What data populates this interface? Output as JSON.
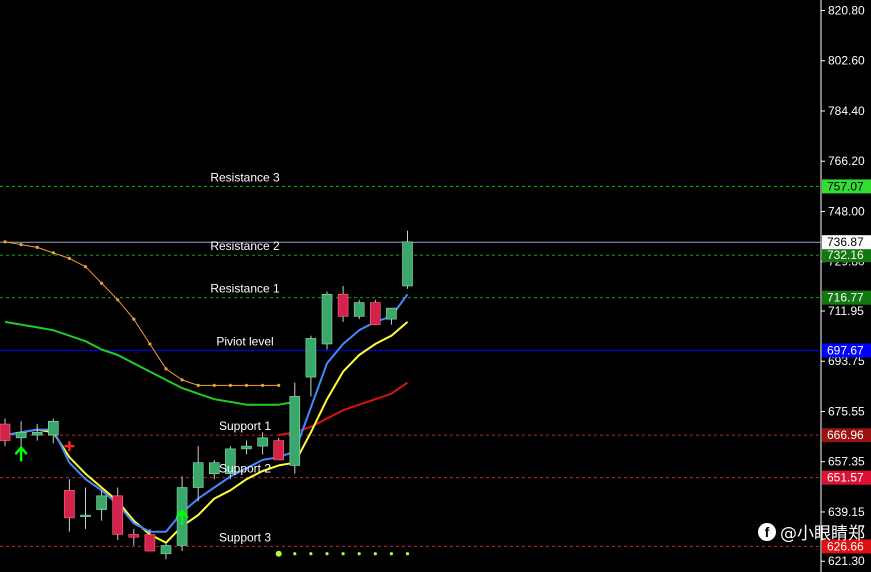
{
  "chart_data": {
    "type": "candlestick",
    "y_axis": {
      "ylim": [
        617.4,
        824.6
      ],
      "ticks": [
        "820.80",
        "802.60",
        "784.40",
        "766.20",
        "748.00",
        "729.80",
        "711.95",
        "693.75",
        "675.55",
        "657.35",
        "639.15",
        "621.30"
      ],
      "tick_values": [
        820.8,
        802.6,
        784.4,
        766.2,
        748.0,
        729.8,
        711.95,
        693.75,
        675.55,
        657.35,
        639.15,
        621.3
      ]
    },
    "candles": [
      {
        "o": 671,
        "h": 673,
        "l": 663,
        "c": 665
      },
      {
        "o": 666,
        "h": 672,
        "l": 663,
        "c": 668
      },
      {
        "o": 667,
        "h": 671,
        "l": 665,
        "c": 668
      },
      {
        "o": 667,
        "h": 673,
        "l": 664,
        "c": 672
      },
      {
        "o": 647,
        "h": 651,
        "l": 632,
        "c": 637
      },
      {
        "o": 638,
        "h": 648,
        "l": 633,
        "c": 638
      },
      {
        "o": 640,
        "h": 647,
        "l": 636,
        "c": 645
      },
      {
        "o": 645,
        "h": 648,
        "l": 629,
        "c": 631
      },
      {
        "o": 631,
        "h": 633,
        "l": 627,
        "c": 630
      },
      {
        "o": 631,
        "h": 633,
        "l": 625,
        "c": 625
      },
      {
        "o": 624,
        "h": 628,
        "l": 622,
        "c": 627
      },
      {
        "o": 627,
        "h": 652,
        "l": 625,
        "c": 648
      },
      {
        "o": 648,
        "h": 663,
        "l": 643,
        "c": 657
      },
      {
        "o": 653,
        "h": 658,
        "l": 651,
        "c": 657
      },
      {
        "o": 653,
        "h": 663,
        "l": 651,
        "c": 662
      },
      {
        "o": 662,
        "h": 665,
        "l": 660,
        "c": 663
      },
      {
        "o": 663,
        "h": 668,
        "l": 660,
        "c": 666
      },
      {
        "o": 665,
        "h": 666,
        "l": 658,
        "c": 658
      },
      {
        "o": 656,
        "h": 686,
        "l": 653,
        "c": 681
      },
      {
        "o": 688,
        "h": 703,
        "l": 681,
        "c": 702
      },
      {
        "o": 700,
        "h": 719,
        "l": 698,
        "c": 718
      },
      {
        "o": 718,
        "h": 721,
        "l": 708,
        "c": 710
      },
      {
        "o": 710,
        "h": 716,
        "l": 709,
        "c": 715
      },
      {
        "o": 715,
        "h": 716,
        "l": 707,
        "c": 707
      },
      {
        "o": 709,
        "h": 713,
        "l": 707,
        "c": 713
      },
      {
        "o": 721,
        "h": 741,
        "l": 720,
        "c": 737
      }
    ],
    "series": [
      {
        "color": "#f0a030",
        "style": "dotted",
        "values": [
          737,
          736,
          735,
          733,
          731,
          728,
          722,
          716,
          709,
          700,
          691,
          687,
          685,
          685,
          685,
          685,
          685,
          685,
          null,
          null,
          null,
          null,
          null,
          null,
          null,
          null
        ]
      },
      {
        "color": "#22cc22",
        "values": [
          708,
          707,
          706,
          705,
          703,
          701,
          698,
          696,
          693,
          690,
          687,
          684,
          682,
          680,
          679,
          678,
          678,
          678,
          679,
          null,
          null,
          null,
          null,
          null,
          null,
          null
        ]
      },
      {
        "color": "#dd1111",
        "values": [
          null,
          null,
          null,
          null,
          null,
          null,
          null,
          null,
          null,
          null,
          null,
          null,
          null,
          null,
          null,
          null,
          null,
          667,
          668,
          670,
          673,
          676,
          678,
          680,
          682,
          686
        ]
      },
      {
        "color": "#ffff33",
        "values": [
          667,
          668,
          669,
          668,
          659,
          653,
          648,
          643,
          636,
          631,
          628,
          634,
          638,
          644,
          647,
          651,
          654,
          656,
          657,
          668,
          680,
          690,
          696,
          700,
          703,
          708
        ]
      },
      {
        "color": "#4488ff",
        "values": [
          667,
          668,
          669,
          669,
          657,
          651,
          647,
          642,
          635,
          632,
          632,
          639,
          644,
          648,
          652,
          655,
          658,
          659,
          661,
          677,
          693,
          700,
          705,
          708,
          710,
          718
        ]
      }
    ],
    "levels": [
      {
        "label": "Resistance 3",
        "value": 757.07,
        "tag": "757.07",
        "color": "#00cc00",
        "tag_bg": "#33dd33",
        "tag_fg": "#000000"
      },
      {
        "label": "Resistance 2",
        "value": 732.16,
        "tag": "732.16",
        "color": "#00aa00",
        "tag_bg": "#117711",
        "tag_fg": "#ffffff"
      },
      {
        "label": "Resistance 1",
        "value": 716.77,
        "tag": "716.77",
        "color": "#00aa00",
        "tag_bg": "#117711",
        "tag_fg": "#ffffff"
      },
      {
        "label": "Piviot level",
        "value": 697.67,
        "tag": "697.67",
        "color": "#0000ff",
        "tag_bg": "#0000ff",
        "tag_fg": "#ffffff"
      },
      {
        "label": "Support 1",
        "value": 666.96,
        "tag": "666.96",
        "color": "#cc2222",
        "tag_bg": "#991111",
        "tag_fg": "#ffffff"
      },
      {
        "label": "Support 2",
        "value": 651.57,
        "tag": "651.57",
        "color": "#cc2222",
        "tag_bg": "#dd1133",
        "tag_fg": "#ffffff"
      },
      {
        "label": "Support 3",
        "value": 626.66,
        "tag": "626.66",
        "color": "#cc2222",
        "tag_bg": "#dd1111",
        "tag_fg": "#ffffff"
      }
    ],
    "current_price": {
      "value": 736.87,
      "tag": "736.87"
    },
    "markers": [
      {
        "type": "up-arrow",
        "candle": 1,
        "value": 660,
        "color": "#00ff00"
      },
      {
        "type": "cross",
        "candle": 4,
        "value": 663,
        "color": "#ff2222"
      },
      {
        "type": "up-arrow",
        "candle": 11,
        "value": 637,
        "color": "#00ff00"
      }
    ],
    "dotted_support": {
      "from_candle": 17,
      "to_candle": 25,
      "value": 624,
      "color": "#aaff33"
    },
    "colors": {
      "bull": "#3aa86a",
      "bear": "#d4234a",
      "wick": "#cccccc",
      "axis_line": "#ffffff"
    }
  },
  "watermark": {
    "logo": "f",
    "text": "@小眼睛郑"
  }
}
